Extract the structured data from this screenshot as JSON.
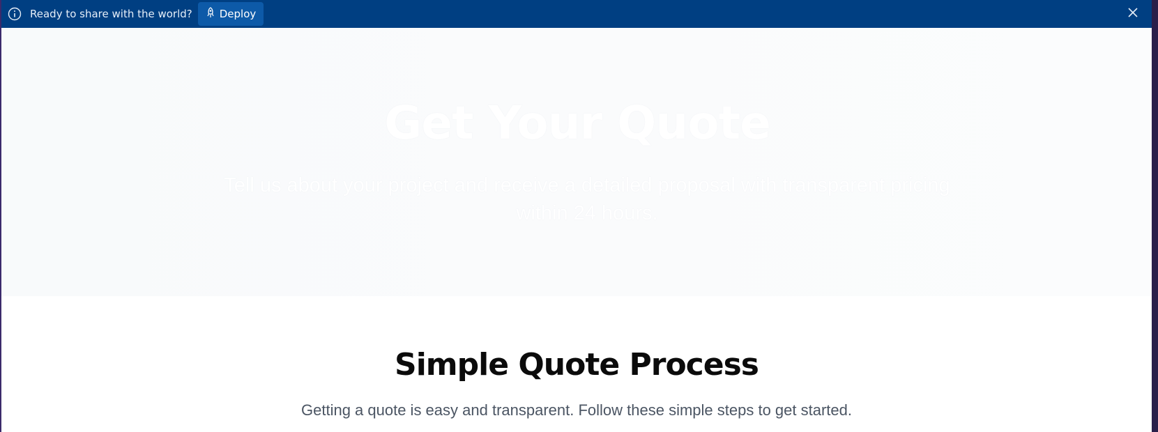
{
  "deploy_bar": {
    "message": "Ready to share with the world?",
    "deploy_label": "Deploy",
    "background": "#003f82",
    "button_color": "#0d5aa8"
  },
  "hero": {
    "title": "Get Your Quote",
    "subtitle": "Tell us about your project and receive a detailed proposal with transparent pricing within 24 hours."
  },
  "process": {
    "title": "Simple Quote Process",
    "subtitle": "Getting a quote is easy and transparent. Follow these simple steps to get started."
  },
  "icons": {
    "info": "info-circle-icon",
    "deploy": "rocket-icon",
    "close": "close-icon"
  }
}
